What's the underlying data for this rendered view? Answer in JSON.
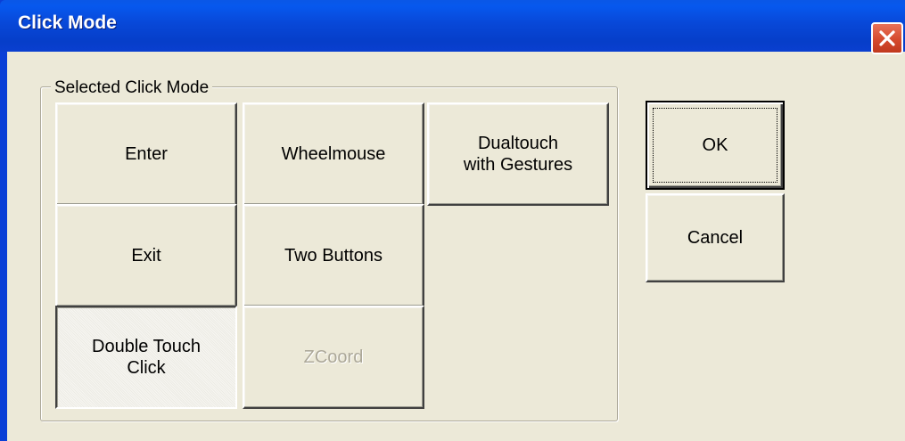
{
  "window": {
    "title": "Click Mode",
    "close_icon": "close-icon"
  },
  "group": {
    "label": "Selected Click Mode",
    "selected": "Double Touch Click",
    "modes": [
      {
        "id": "enter",
        "label": "Enter",
        "state": "normal"
      },
      {
        "id": "exit",
        "label": "Exit",
        "state": "normal"
      },
      {
        "id": "double-touch-click",
        "label": "Double Touch\nClick",
        "state": "selected"
      },
      {
        "id": "wheelmouse",
        "label": "Wheelmouse",
        "state": "normal"
      },
      {
        "id": "two-buttons",
        "label": "Two Buttons",
        "state": "normal"
      },
      {
        "id": "zcoord",
        "label": "ZCoord",
        "state": "disabled"
      },
      {
        "id": "dualtouch-with-gestures",
        "label": "Dualtouch\nwith Gestures",
        "state": "normal"
      }
    ]
  },
  "actions": {
    "ok_label": "OK",
    "cancel_label": "Cancel"
  },
  "colors": {
    "titlebar": "#0848d8",
    "face": "#ece9d8",
    "close_button": "#d54a2d",
    "disabled_text": "#aca899"
  }
}
